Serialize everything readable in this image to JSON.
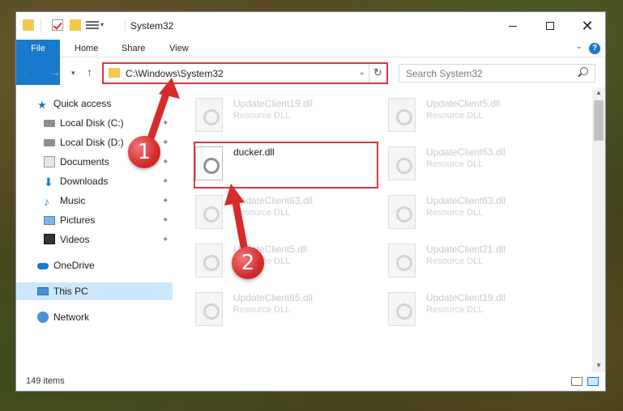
{
  "window": {
    "title": "System32",
    "controls": {
      "minimize": "minimize",
      "maximize": "maximize",
      "close": "✕"
    }
  },
  "ribbon": {
    "tabs": [
      "File",
      "Home",
      "Share",
      "View"
    ],
    "help": "?"
  },
  "nav": {
    "address": "C:\\Windows\\System32",
    "search_placeholder": "Search System32"
  },
  "sidebar": {
    "items": [
      {
        "label": "Quick access",
        "icon": "star-icon",
        "pinned": false
      },
      {
        "label": "Local Disk (C:)",
        "icon": "disk-icon",
        "pinned": true
      },
      {
        "label": "Local Disk (D:)",
        "icon": "disk-icon",
        "pinned": true
      },
      {
        "label": "Documents",
        "icon": "documents-icon",
        "pinned": true
      },
      {
        "label": "Downloads",
        "icon": "downloads-icon",
        "pinned": true
      },
      {
        "label": "Music",
        "icon": "music-icon",
        "pinned": true
      },
      {
        "label": "Pictures",
        "icon": "pictures-icon",
        "pinned": true
      },
      {
        "label": "Videos",
        "icon": "videos-icon",
        "pinned": true
      },
      {
        "label": "OneDrive",
        "icon": "cloud-icon",
        "pinned": false
      },
      {
        "label": "This PC",
        "icon": "pc-icon",
        "pinned": false,
        "selected": true
      },
      {
        "label": "Network",
        "icon": "network-icon",
        "pinned": false
      }
    ]
  },
  "files": [
    {
      "name": "UpdateClient19.dll",
      "type": "Resource DLL"
    },
    {
      "name": "UpdateClient5.dll",
      "type": "Resource DLL"
    },
    {
      "name": "ducker.dll",
      "type": "",
      "highlighted": true
    },
    {
      "name": "UpdateClient63.dll",
      "type": "Resource DLL"
    },
    {
      "name": "UpdateClient63.dll",
      "type": "Resource DLL"
    },
    {
      "name": "UpdateClient63.dll",
      "type": "Resource DLL"
    },
    {
      "name": "UpdateClient5.dll",
      "type": "Resource DLL"
    },
    {
      "name": "UpdateClient21.dll",
      "type": "Resource DLL"
    },
    {
      "name": "UpdateClient65.dll",
      "type": "Resource DLL"
    },
    {
      "name": "UpdateClient19.dll",
      "type": "Resource DLL"
    }
  ],
  "status": {
    "item_count": "149 items"
  },
  "annotations": {
    "step1": "1",
    "step2": "2",
    "color": "#d9363e"
  }
}
